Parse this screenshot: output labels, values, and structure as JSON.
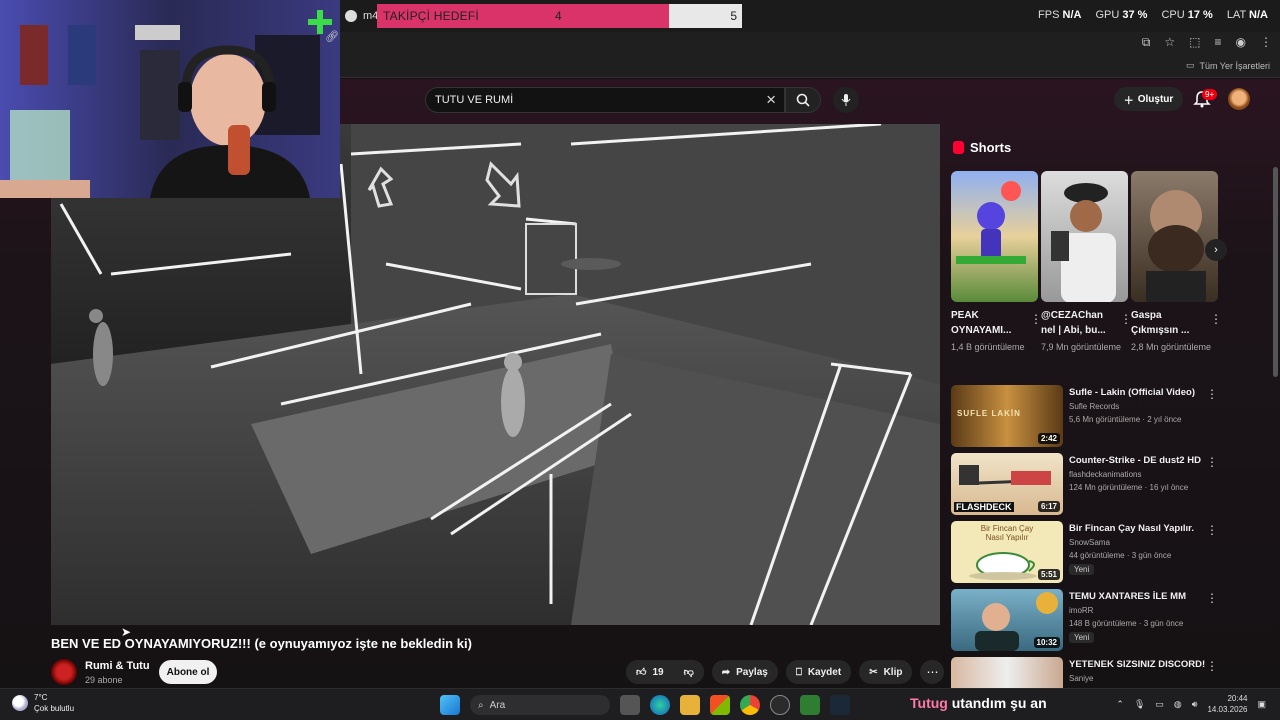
{
  "browser": {
    "tab_title": "m4",
    "follower_goal": {
      "label": "TAKİPÇİ HEDEFİ",
      "current": "4",
      "goal": "5",
      "progress": 0.8
    },
    "stats": [
      {
        "label": "FPS",
        "value": "N/A"
      },
      {
        "label": "GPU",
        "value": "37 %"
      },
      {
        "label": "CPU",
        "value": "17 %"
      },
      {
        "label": "LAT",
        "value": "N/A"
      }
    ],
    "all_bookmarks": "Tüm Yer İşaretleri"
  },
  "youtube": {
    "search_value": "TUTU VE RUMİ",
    "create_label": "Oluştur",
    "notification_count": "9+",
    "video": {
      "title": "BEN VE ED OYNAYAMIYORUZ!!! (e oynuyamıyoz işte ne bekledin ki)",
      "channel": "Rumi & Tutu",
      "subscribers": "29 abone",
      "subscribe_label": "Abone ol",
      "likes": "19",
      "share_label": "Paylaş",
      "save_label": "Kaydet",
      "clip_label": "Klip"
    },
    "shorts_label": "Shorts",
    "shorts": [
      {
        "title": "PEAK OYNAYAMI...",
        "views": "1,4 B görüntüleme"
      },
      {
        "title": "@CEZAChan nel | Abi, bu...",
        "views": "7,9 Mn görüntüleme"
      },
      {
        "title": "Gaspa Çıkmışsın ...",
        "views": "2,8 Mn görüntüleme"
      }
    ],
    "recommendations": [
      {
        "title": "Sufle - Lakin (Official Video)",
        "channel": "Sufle Records",
        "meta": "5,6 Mn görüntüleme · 2 yıl önce",
        "duration": "2:42",
        "badge": ""
      },
      {
        "title": "Counter-Strike - DE dust2 HD",
        "channel": "flashdeckanimations",
        "meta": "124 Mn görüntüleme · 16 yıl önce",
        "duration": "6:17",
        "badge": ""
      },
      {
        "title": "Bir Fincan Çay Nasıl Yapılır.",
        "channel": "SnowSama",
        "meta": "44 görüntüleme · 3 gün önce",
        "duration": "5:51",
        "badge": "Yeni"
      },
      {
        "title": "TEMU XANTARES İLE MM",
        "channel": "imoRR",
        "meta": "148 B görüntüleme · 3 gün önce",
        "duration": "10:32",
        "badge": "Yeni"
      },
      {
        "title": "YETENEK SIZSINIZ DISCORD!",
        "channel": "Saniye",
        "meta": "",
        "duration": "",
        "badge": ""
      }
    ],
    "thumb_text": {
      "sufle": "SUFLE   LAKİN",
      "flashdeck": "FLASHDECK",
      "tea": "Bir Fincan Çay Nasıl Yapılır"
    }
  },
  "taskbar": {
    "weather_temp": "7°C",
    "weather_desc": "Çok bulutlu",
    "search_label": "Ara",
    "time": "20:44",
    "date": "14.03.2026"
  },
  "stream_caption": {
    "name": "Tutug",
    "message": "utandım şu an"
  }
}
